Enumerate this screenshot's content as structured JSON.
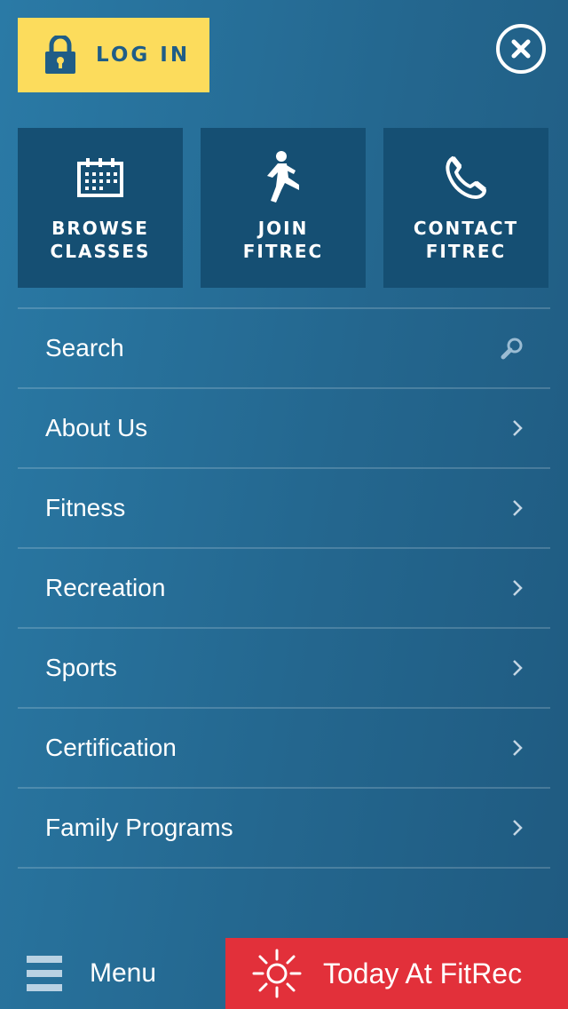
{
  "header": {
    "login_label": "LOG IN",
    "login_icon": "lock-icon",
    "close_icon": "close-icon"
  },
  "colors": {
    "login_bg": "#fcdc5c",
    "login_text": "#1f5d87",
    "tile_bg": "#154f73",
    "today_bg": "#e2303a"
  },
  "tiles": [
    {
      "label": "BROWSE\nCLASSES",
      "icon": "calendar-icon"
    },
    {
      "label": "JOIN\nFITREC",
      "icon": "running-person-icon"
    },
    {
      "label": "CONTACT\nFITREC",
      "icon": "phone-icon"
    }
  ],
  "menu": {
    "search_label": "Search",
    "items": [
      {
        "label": "About Us"
      },
      {
        "label": "Fitness"
      },
      {
        "label": "Recreation"
      },
      {
        "label": "Sports"
      },
      {
        "label": "Certification"
      },
      {
        "label": "Family Programs"
      }
    ]
  },
  "bottom_bar": {
    "menu_label": "Menu",
    "today_label": "Today At FitRec"
  }
}
